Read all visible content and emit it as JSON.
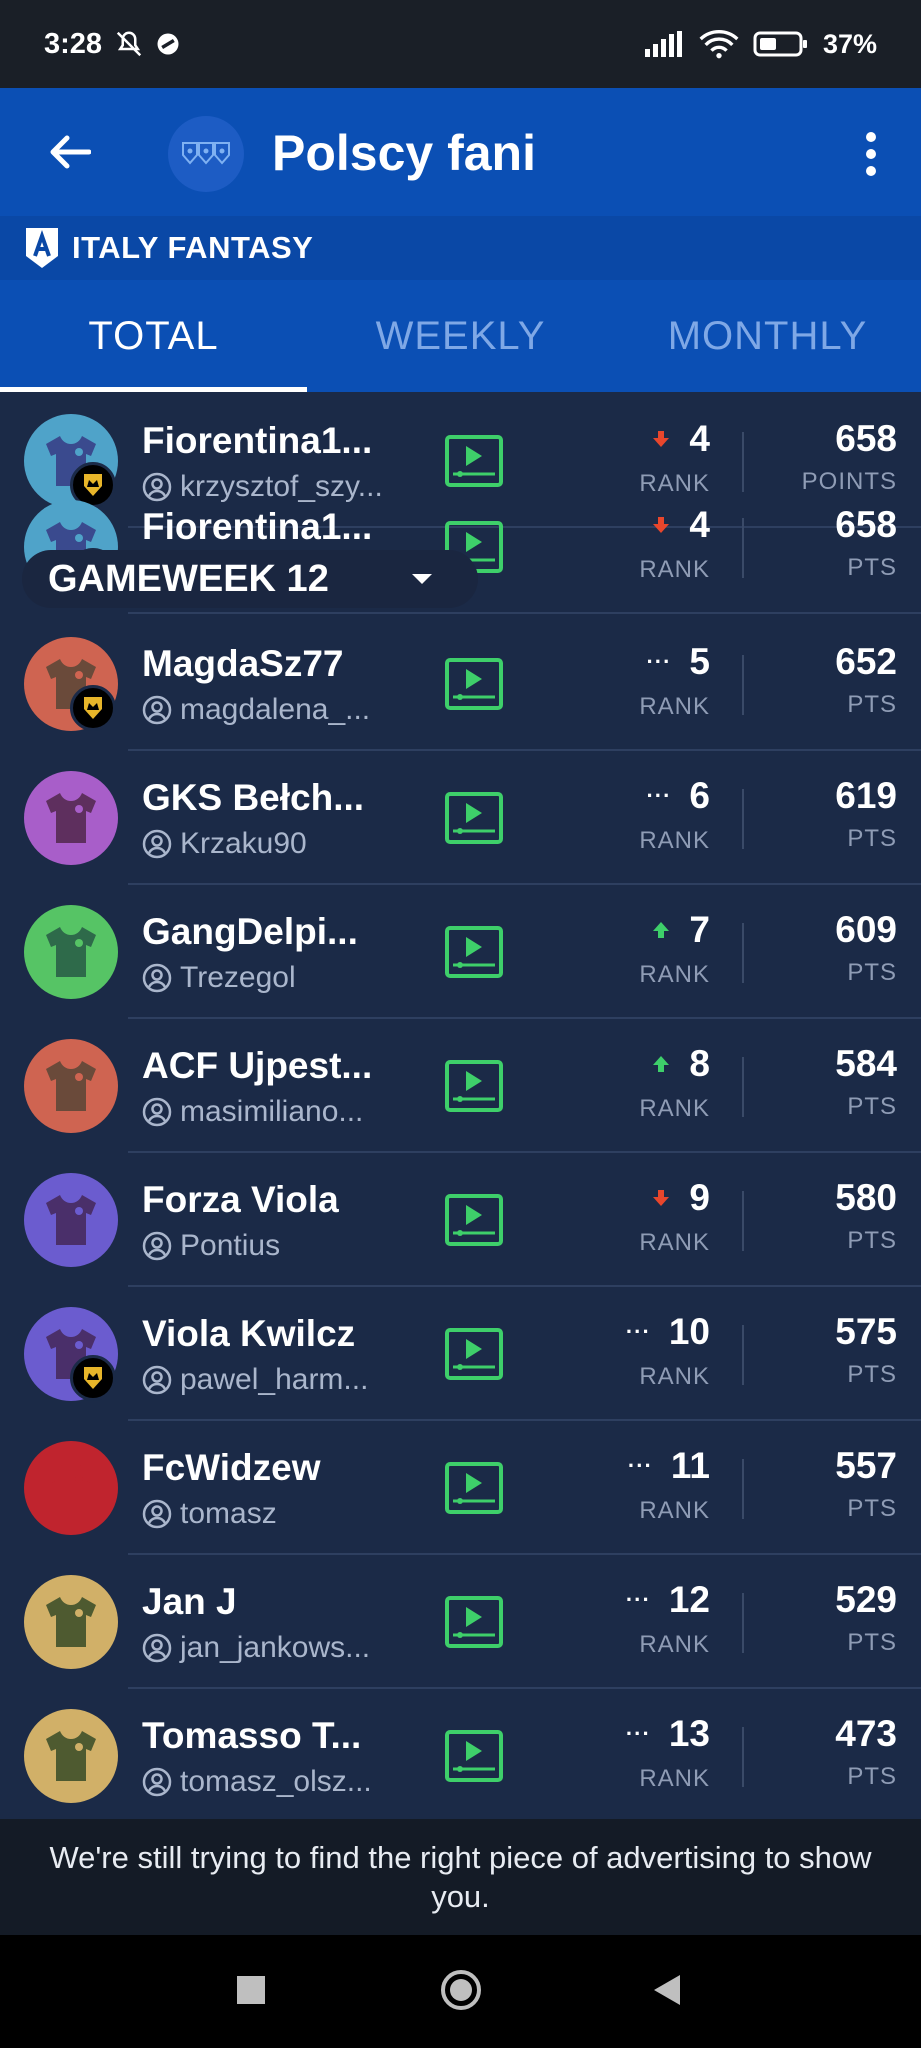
{
  "status": {
    "time": "3:28",
    "battery": "37%"
  },
  "header": {
    "title": "Polscy fani",
    "brand": "ITALY FANTASY"
  },
  "tabs": [
    {
      "label": "TOTAL",
      "active": true
    },
    {
      "label": "WEEKLY",
      "active": false
    },
    {
      "label": "MONTHLY",
      "active": false
    }
  ],
  "gameweek": {
    "label": "GAMEWEEK 12"
  },
  "rows": [
    {
      "team": "Fiorentina1...",
      "manager": "krzysztof_szy...",
      "rank": "4",
      "trend": "down",
      "points": "658",
      "rank_label": "RANK",
      "points_label": "POINTS",
      "avatar_color": "#4fa3c9",
      "shirt_color": "#3a4a8e",
      "crown": true
    },
    {
      "team": "Fiorentina1...",
      "manager": "krzysztof_szy...",
      "rank": "4",
      "trend": "down",
      "points": "658",
      "rank_label": "RANK",
      "points_label": "PTS",
      "avatar_color": "#4fa3c9",
      "shirt_color": "#3a4a8e",
      "crown": true
    },
    {
      "team": "MagdaSz77",
      "manager": "magdalena_...",
      "rank": "5",
      "trend": "same",
      "points": "652",
      "rank_label": "RANK",
      "points_label": "PTS",
      "avatar_color": "#cf6451",
      "shirt_color": "#6a4a3a",
      "crown": true
    },
    {
      "team": "GKS Bełch...",
      "manager": "Krzaku90",
      "rank": "6",
      "trend": "same",
      "points": "619",
      "rank_label": "RANK",
      "points_label": "PTS",
      "avatar_color": "#a85ec9",
      "shirt_color": "#5e2f5e",
      "crown": false
    },
    {
      "team": "GangDelpi...",
      "manager": "Trezegol",
      "rank": "7",
      "trend": "up",
      "points": "609",
      "rank_label": "RANK",
      "points_label": "PTS",
      "avatar_color": "#56c465",
      "shirt_color": "#2e6a4a",
      "crown": false
    },
    {
      "team": "ACF Ujpest...",
      "manager": "masimiliano...",
      "rank": "8",
      "trend": "up",
      "points": "584",
      "rank_label": "RANK",
      "points_label": "PTS",
      "avatar_color": "#cf6451",
      "shirt_color": "#6a4a3a",
      "crown": false
    },
    {
      "team": "Forza Viola",
      "manager": "Pontius",
      "rank": "9",
      "trend": "down",
      "points": "580",
      "rank_label": "RANK",
      "points_label": "PTS",
      "avatar_color": "#6b5ccf",
      "shirt_color": "#4a2f6a",
      "crown": false
    },
    {
      "team": "Viola Kwilcz",
      "manager": "pawel_harm...",
      "rank": "10",
      "trend": "same",
      "points": "575",
      "rank_label": "RANK",
      "points_label": "PTS",
      "avatar_color": "#6b5ccf",
      "shirt_color": "#4a2f6a",
      "crown": true
    },
    {
      "team": "FcWidzew",
      "manager": "tomasz",
      "rank": "11",
      "trend": "same",
      "points": "557",
      "rank_label": "RANK",
      "points_label": "PTS",
      "avatar_color": "#c0242e",
      "shirt_color": "#c0242e",
      "crown": false
    },
    {
      "team": "Jan J",
      "manager": "jan_jankows...",
      "rank": "12",
      "trend": "same",
      "points": "529",
      "rank_label": "RANK",
      "points_label": "PTS",
      "avatar_color": "#d1b068",
      "shirt_color": "#4e5a30",
      "crown": false
    },
    {
      "team": "Tomasso T...",
      "manager": "tomasz_olsz...",
      "rank": "13",
      "trend": "same",
      "points": "473",
      "rank_label": "RANK",
      "points_label": "PTS",
      "avatar_color": "#d1b068",
      "shirt_color": "#4e5a30",
      "crown": false
    }
  ],
  "ad": {
    "text": "We're still trying to find the right piece of advertising to show you."
  },
  "colors": {
    "appbar": "#0b4fb4",
    "background": "#1b2a47",
    "watch": "#3ecf6a",
    "down": "#e8462c",
    "up": "#3ecf6a"
  }
}
